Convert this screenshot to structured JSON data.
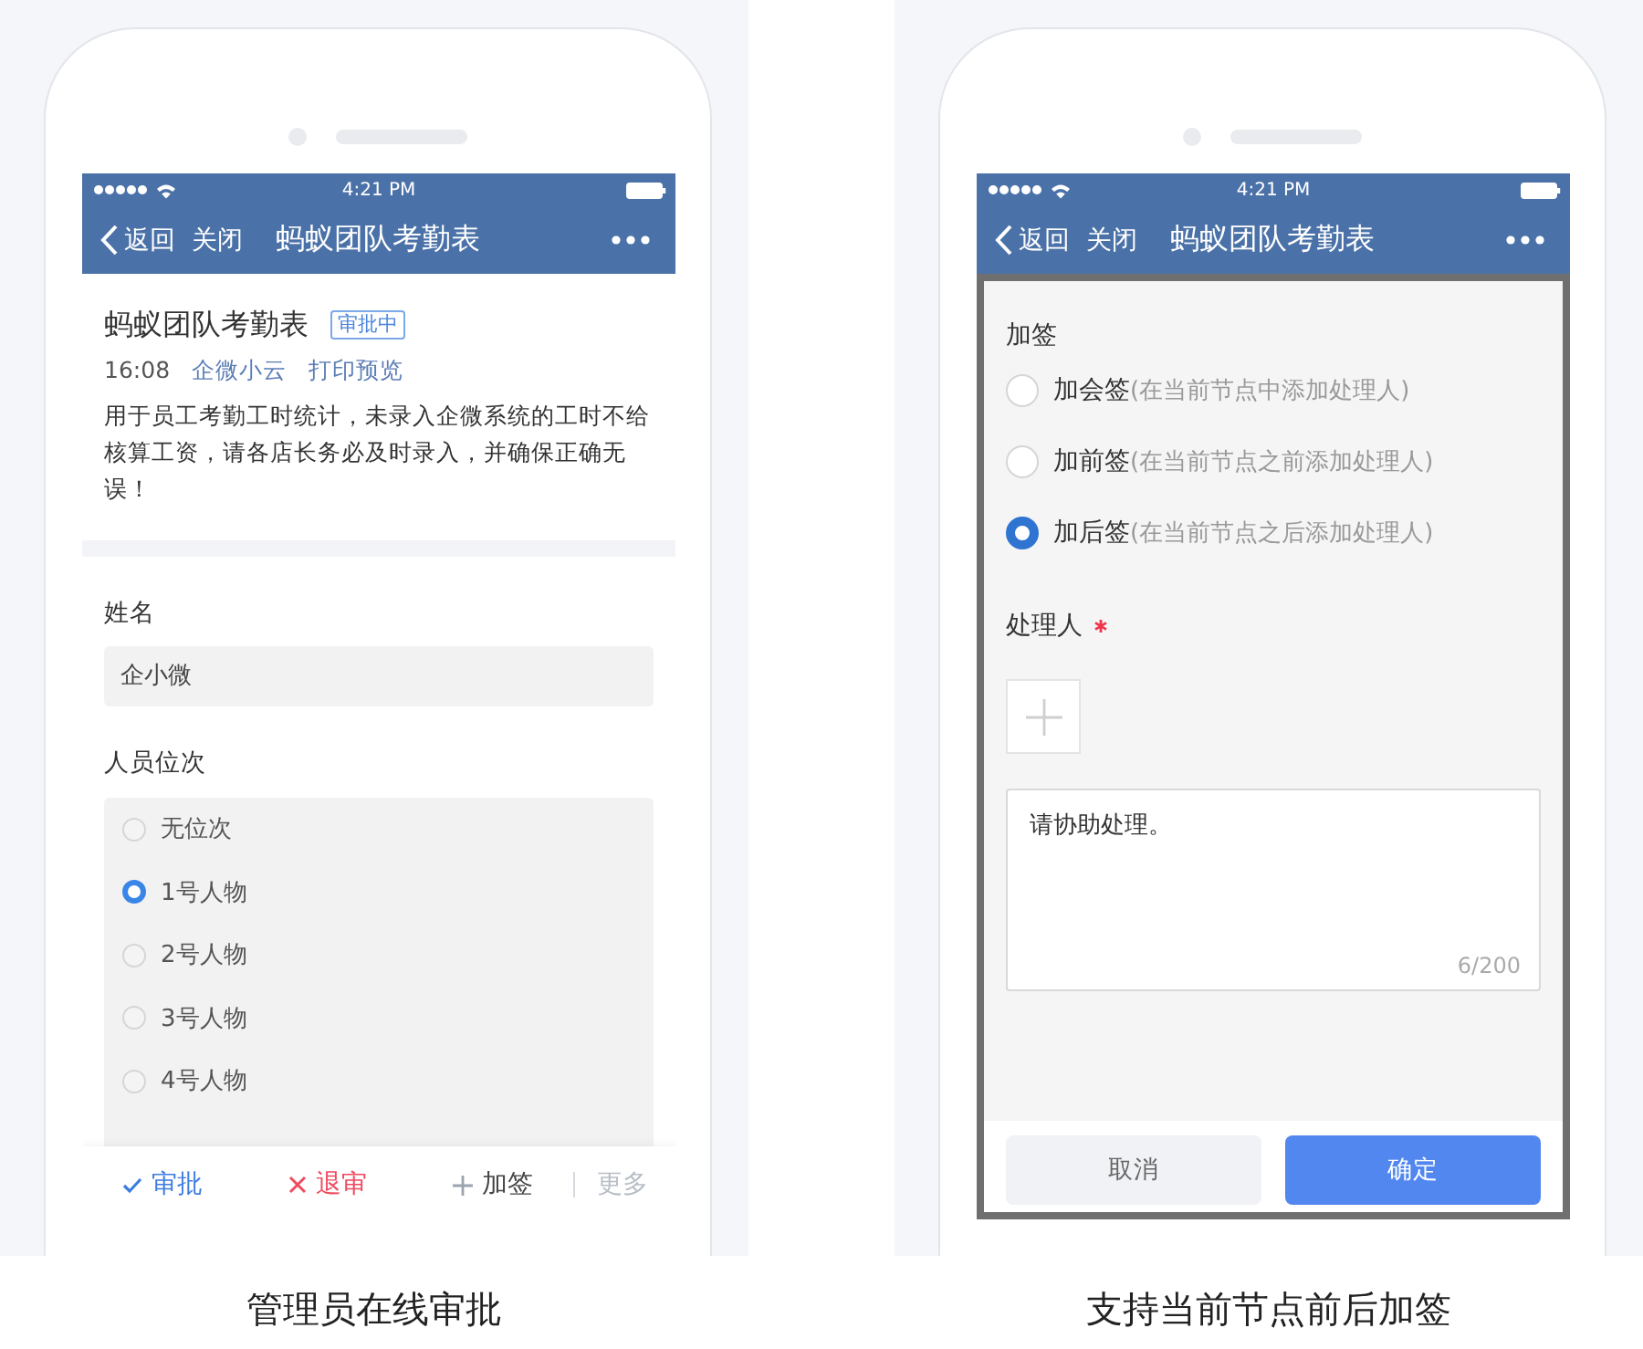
{
  "approval_screen": {
    "status_bar": {
      "time": "4:21 PM"
    },
    "nav_bar": {
      "back": "返回",
      "close": "关闭",
      "title": "蚂蚁团队考勤表"
    },
    "header": {
      "title": "蚂蚁团队考勤表",
      "badge": "审批中",
      "time": "16:08",
      "author": "企微小云",
      "print_link": "打印预览",
      "description": "用于员工考勤工时统计，未录入企微系统的工时不给核算工资，请各店长务必及时录入，并确保正确无误！"
    },
    "fields": [
      {
        "kind": "text",
        "label": "姓名",
        "value": "企小微"
      },
      {
        "kind": "radio",
        "label": "人员位次",
        "options": [
          {
            "label": "无位次",
            "selected": false
          },
          {
            "label": "1号人物",
            "selected": true
          },
          {
            "label": "2号人物",
            "selected": false
          },
          {
            "label": "3号人物",
            "selected": false
          },
          {
            "label": "4号人物",
            "selected": false
          }
        ]
      }
    ],
    "actions": [
      {
        "kind": "approve",
        "label": "审批"
      },
      {
        "kind": "reject",
        "label": "退审"
      },
      {
        "kind": "add",
        "label": "加签"
      },
      {
        "kind": "more",
        "label": "更多"
      }
    ],
    "caption": "管理员在线审批"
  },
  "countersign_screen": {
    "status_bar": {
      "time": "4:21 PM"
    },
    "nav_bar": {
      "back": "返回",
      "close": "关闭",
      "title": "蚂蚁团队考勤表"
    },
    "dialog": {
      "title": "加签",
      "options": [
        {
          "label": "加会签",
          "hint": "(在当前节点中添加处理人)",
          "selected": false
        },
        {
          "label": "加前签",
          "hint": "(在当前节点之前添加处理人)",
          "selected": false
        },
        {
          "label": "加后签",
          "hint": "(在当前节点之后添加处理人)",
          "selected": true
        }
      ],
      "assignee_label": "处理人",
      "required": true,
      "comment": "请协助处理。",
      "counter": "6/200",
      "buttons": [
        {
          "kind": "secondary",
          "label": "取消"
        },
        {
          "kind": "primary",
          "label": "确定"
        }
      ]
    },
    "caption": "支持当前节点前后加签"
  }
}
